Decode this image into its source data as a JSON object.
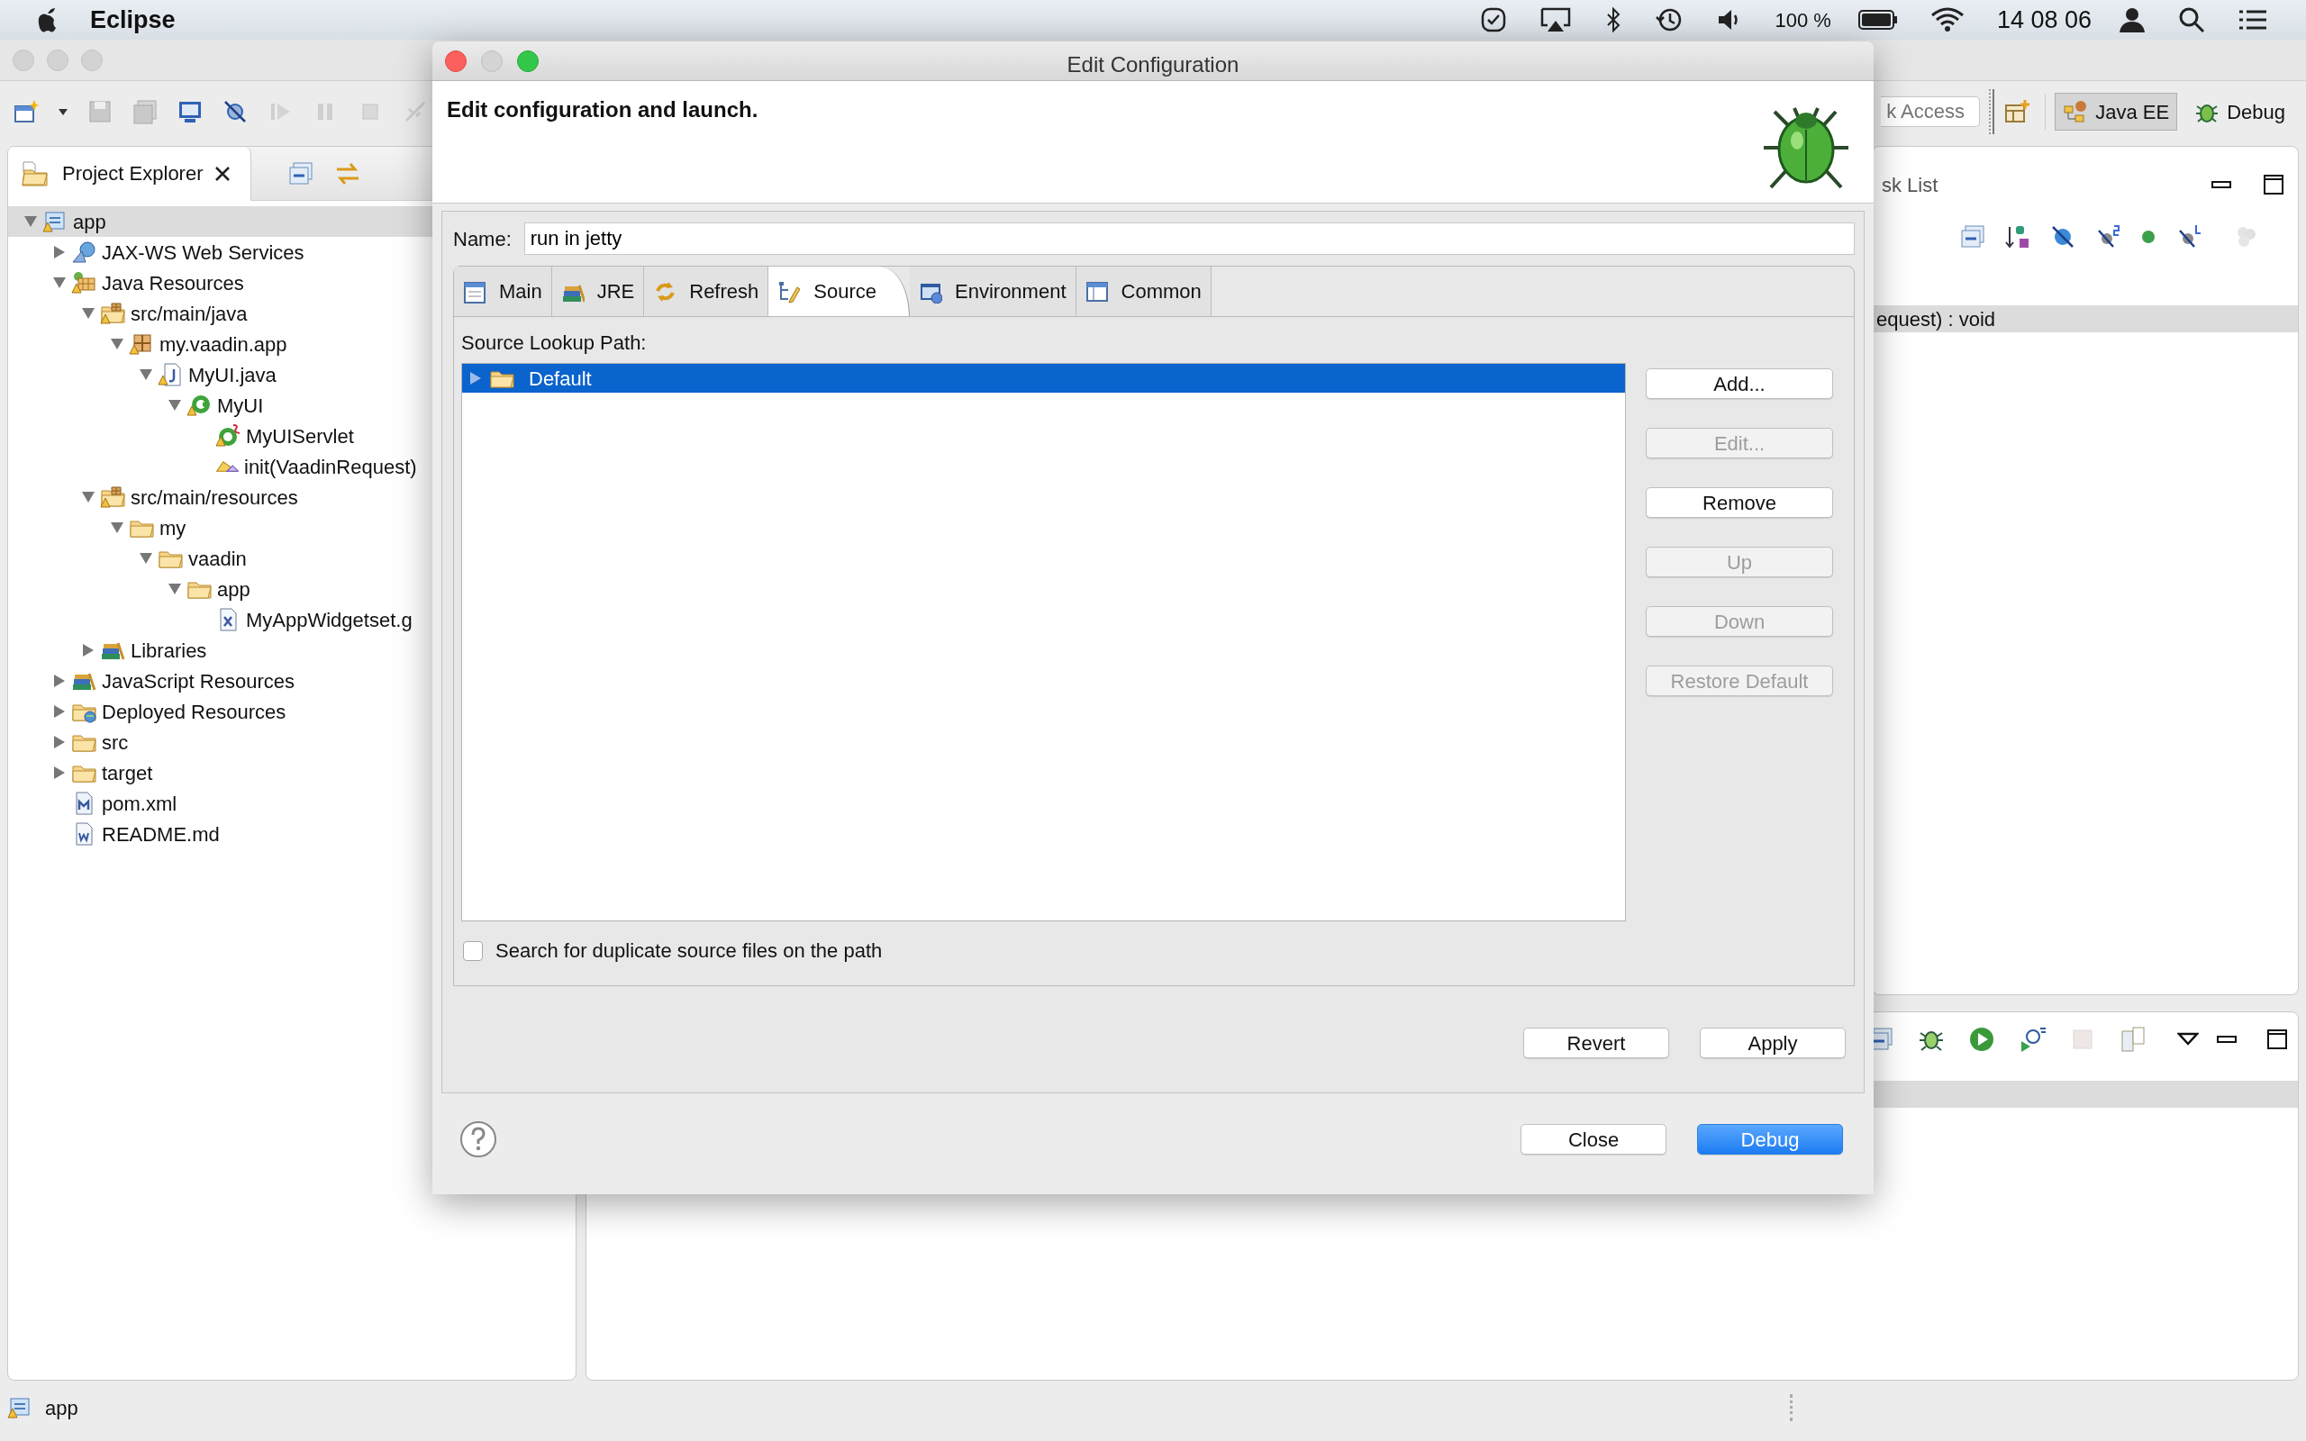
{
  "menubar": {
    "app_name": "Eclipse",
    "battery": "100 %",
    "clock": "14 08 06"
  },
  "toolbar": {
    "quick_access_placeholder": "k Access",
    "perspectives": [
      {
        "label": "Java EE",
        "kind": "javaee",
        "selected": true
      },
      {
        "label": "Debug",
        "kind": "debug",
        "selected": false
      }
    ]
  },
  "project_explorer": {
    "title": "Project Explorer",
    "tree": [
      {
        "label": "app",
        "kind": "project",
        "expanded": true,
        "selected": true,
        "children": [
          {
            "label": "JAX-WS Web Services",
            "kind": "web-services",
            "expanded": false,
            "selected": false
          },
          {
            "label": "Java Resources",
            "kind": "java-resources",
            "expanded": true,
            "selected": false,
            "children": [
              {
                "label": "src/main/java",
                "kind": "source-folder",
                "expanded": true,
                "selected": false,
                "children": [
                  {
                    "label": "my.vaadin.app",
                    "kind": "package",
                    "expanded": true,
                    "selected": false,
                    "children": [
                      {
                        "label": "MyUI.java",
                        "kind": "java-file",
                        "expanded": true,
                        "selected": false,
                        "children": [
                          {
                            "label": "MyUI",
                            "kind": "class",
                            "expanded": true,
                            "selected": false,
                            "children": [
                              {
                                "label": "MyUIServlet",
                                "kind": "servlet-class",
                                "selected": false
                              },
                              {
                                "label": "init(VaadinRequest)",
                                "kind": "method",
                                "selected": false
                              }
                            ]
                          }
                        ]
                      }
                    ]
                  }
                ]
              },
              {
                "label": "src/main/resources",
                "kind": "source-folder",
                "expanded": true,
                "selected": false,
                "children": [
                  {
                    "label": "my",
                    "kind": "folder",
                    "expanded": true,
                    "selected": false,
                    "children": [
                      {
                        "label": "vaadin",
                        "kind": "folder",
                        "expanded": true,
                        "selected": false,
                        "children": [
                          {
                            "label": "app",
                            "kind": "folder",
                            "expanded": true,
                            "selected": false,
                            "children": [
                              {
                                "label": "MyAppWidgetset.g",
                                "kind": "xml-file",
                                "selected": false
                              }
                            ]
                          }
                        ]
                      }
                    ]
                  }
                ]
              },
              {
                "label": "Libraries",
                "kind": "library",
                "expanded": false,
                "selected": false
              }
            ]
          },
          {
            "label": "JavaScript Resources",
            "kind": "library",
            "expanded": false,
            "selected": false
          },
          {
            "label": "Deployed Resources",
            "kind": "deployed",
            "expanded": false,
            "selected": false
          },
          {
            "label": "src",
            "kind": "folder",
            "expanded": false,
            "selected": false
          },
          {
            "label": "target",
            "kind": "folder",
            "expanded": false,
            "selected": false
          },
          {
            "label": "pom.xml",
            "kind": "pom-file",
            "selected": false
          },
          {
            "label": "README.md",
            "kind": "text-file",
            "selected": false
          }
        ]
      }
    ]
  },
  "outline_panel": {
    "tab_title": "sk List",
    "selected_row": "equest) : void"
  },
  "status_bar": {
    "text": "app"
  },
  "dialog": {
    "title": "Edit Configuration",
    "heading": "Edit configuration and launch.",
    "name_label": "Name:",
    "name_value": "run in jetty",
    "tabs": [
      {
        "label": "Main",
        "kind": "main",
        "selected": false
      },
      {
        "label": "JRE",
        "kind": "jre",
        "selected": false
      },
      {
        "label": "Refresh",
        "kind": "refresh",
        "selected": false
      },
      {
        "label": "Source",
        "kind": "source",
        "selected": true
      },
      {
        "label": "Environment",
        "kind": "environment",
        "selected": false
      },
      {
        "label": "Common",
        "kind": "common",
        "selected": false
      }
    ],
    "lookup_label": "Source Lookup Path:",
    "lookup_items": [
      {
        "label": "Default",
        "expanded": false,
        "selected": true
      }
    ],
    "side_buttons": [
      {
        "label": "Add...",
        "disabled": false
      },
      {
        "label": "Edit...",
        "disabled": true
      },
      {
        "label": "Remove",
        "disabled": false
      },
      {
        "label": "Up",
        "disabled": true
      },
      {
        "label": "Down",
        "disabled": true
      },
      {
        "label": "Restore Default",
        "disabled": true
      }
    ],
    "duplicate_check": {
      "label": "Search for duplicate source files on the path",
      "checked": false
    },
    "apply_buttons": [
      {
        "label": "Revert",
        "primary": false
      },
      {
        "label": "Apply",
        "primary": false
      }
    ],
    "footer_buttons": [
      {
        "label": "Close",
        "primary": false
      },
      {
        "label": "Debug",
        "primary": true
      }
    ]
  }
}
